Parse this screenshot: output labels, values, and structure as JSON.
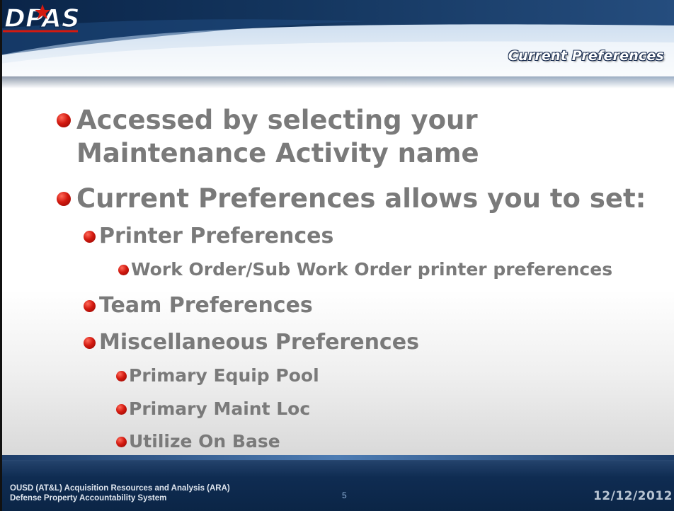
{
  "header": {
    "logo_text": "DPAS",
    "section_title": "Current Preferences"
  },
  "bullets": [
    {
      "level": 1,
      "lines": [
        "Accessed by selecting your",
        "Maintenance Activity name"
      ]
    },
    {
      "level": 1,
      "lines": [
        "Current Preferences allows you to set:"
      ]
    },
    {
      "level": 2,
      "lines": [
        "Printer Preferences"
      ]
    },
    {
      "level": 3,
      "lines": [
        "Work Order/Sub Work Order printer preferences"
      ]
    },
    {
      "level": 2,
      "lines": [
        "Team Preferences"
      ]
    },
    {
      "level": 2,
      "lines": [
        "Miscellaneous Preferences"
      ]
    },
    {
      "level": 3,
      "lines": [
        "Primary Equip Pool"
      ]
    },
    {
      "level": 3,
      "lines": [
        "Primary Maint Loc"
      ]
    },
    {
      "level": 3,
      "lines": [
        "Utilize On Base"
      ]
    }
  ],
  "footer": {
    "org_line1": "OUSD (AT&L) Acquisition Resources and Analysis (ARA)",
    "org_line2": "Defense Property Accountability System",
    "page_number": "5",
    "date": "12/12/2012"
  },
  "colors": {
    "bullet_text": "#7a7a7a",
    "bullet_dot": "#d31a10",
    "header_navy": "#0d2a52",
    "footer_navy": "#0f2c52"
  }
}
